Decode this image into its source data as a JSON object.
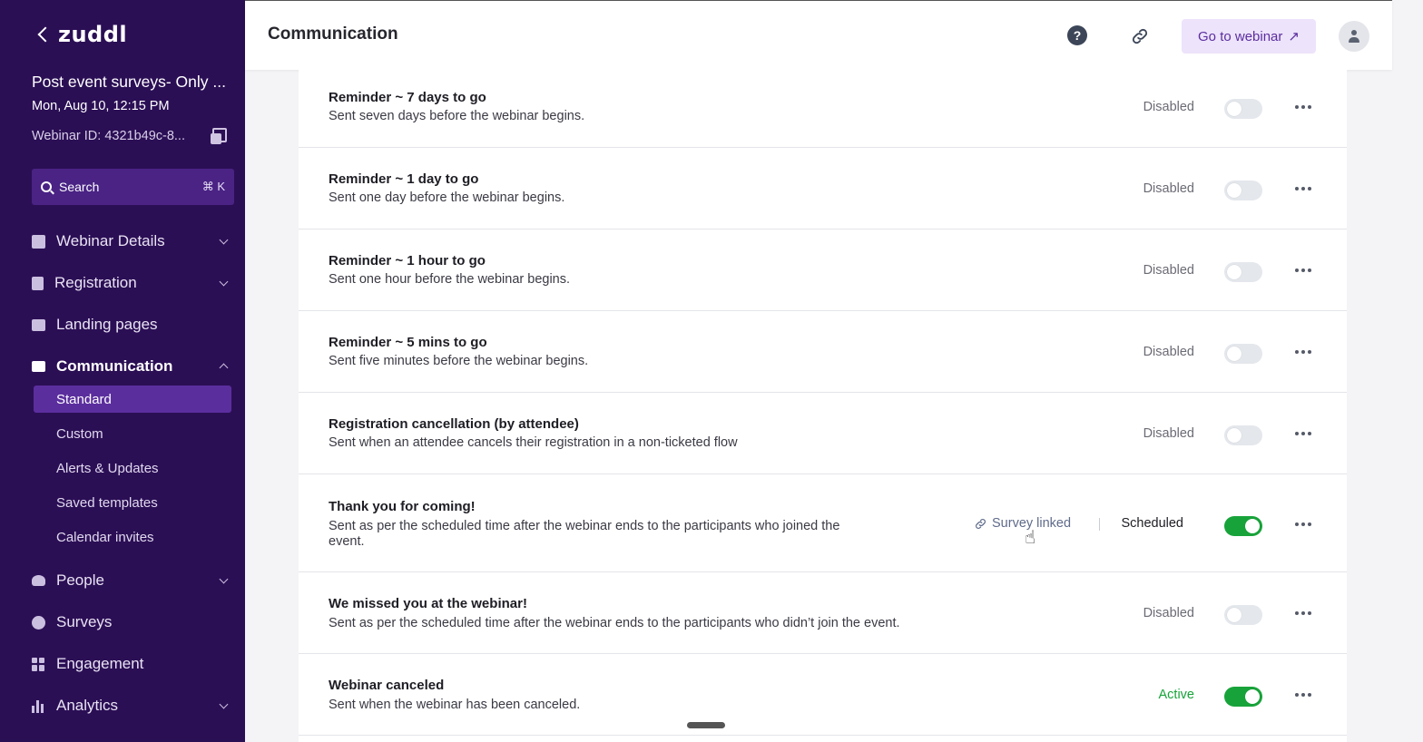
{
  "sidebar": {
    "logo": "zuddl",
    "event_title": "Post event surveys- Only ...",
    "event_date": "Mon, Aug 10, 12:15 PM",
    "webinar_id": "Webinar ID: 4321b49c-8...",
    "search": {
      "label": "Search",
      "shortcut": "⌘ K"
    },
    "nav": {
      "webinar_details": "Webinar Details",
      "registration": "Registration",
      "landing_pages": "Landing pages",
      "communication": "Communication",
      "people": "People",
      "surveys": "Surveys",
      "engagement": "Engagement",
      "analytics": "Analytics"
    },
    "subnav": {
      "standard": "Standard",
      "custom": "Custom",
      "alerts": "Alerts & Updates",
      "saved_templates": "Saved templates",
      "calendar_invites": "Calendar invites"
    }
  },
  "header": {
    "title": "Communication",
    "help_glyph": "?",
    "go_button": "Go to webinar",
    "go_arrow": "↗"
  },
  "rows": [
    {
      "title": "Reminder ~ 7 days to go",
      "desc": "Sent seven days before the webinar begins.",
      "status": "Disabled",
      "toggle_on": false
    },
    {
      "title": "Reminder ~ 1 day to go",
      "desc": "Sent one day before the webinar begins.",
      "status": "Disabled",
      "toggle_on": false
    },
    {
      "title": "Reminder ~ 1 hour to go",
      "desc": "Sent one hour before the webinar begins.",
      "status": "Disabled",
      "toggle_on": false
    },
    {
      "title": "Reminder ~ 5 mins to go",
      "desc": "Sent five minutes before the webinar begins.",
      "status": "Disabled",
      "toggle_on": false
    },
    {
      "title": "Registration cancellation (by attendee)",
      "desc": "Sent when an attendee cancels their registration in a non-ticketed flow",
      "status": "Disabled",
      "toggle_on": false
    },
    {
      "title": "Thank you for coming!",
      "desc": "Sent as per the scheduled time after the webinar ends to the participants who joined the event.",
      "status": "Scheduled",
      "toggle_on": true,
      "survey": "Survey linked"
    },
    {
      "title": "We missed you at the webinar!",
      "desc": "Sent as per the scheduled time after the webinar ends to the participants who didn’t join the event.",
      "status": "Disabled",
      "toggle_on": false
    },
    {
      "title": "Webinar canceled",
      "desc": "Sent when the webinar has been canceled.",
      "status": "Active",
      "toggle_on": true
    }
  ],
  "colors": {
    "sidebar_bg": "#2b0f55",
    "selected_bg": "#5b2e9e",
    "toggle_on": "#18a33a",
    "active_status": "#18a33a",
    "button_bg": "#ede3fb"
  }
}
